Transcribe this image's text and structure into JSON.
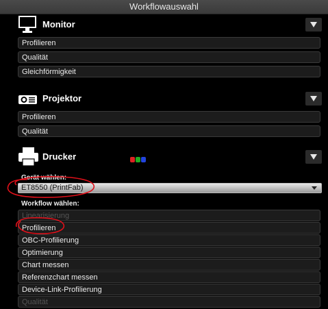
{
  "window": {
    "title": "Workflowauswahl"
  },
  "monitor": {
    "title": "Monitor",
    "items": [
      "Profilieren",
      "Qualität",
      "Gleichförmigkeit"
    ]
  },
  "projector": {
    "title": "Projektor",
    "items": [
      "Profilieren",
      "Qualität"
    ]
  },
  "printer": {
    "title": "Drucker",
    "device_label": "Gerät wählen:",
    "device_value": "ET8550  (PrintFab)",
    "workflow_label": "Workflow wählen:",
    "items": [
      {
        "label": "Linearisierung",
        "enabled": false
      },
      {
        "label": "Profilieren",
        "enabled": true
      },
      {
        "label": "OBC-Profilierung",
        "enabled": true
      },
      {
        "label": "Optimierung",
        "enabled": true
      },
      {
        "label": "Chart messen",
        "enabled": true
      },
      {
        "label": "Referenzchart messen",
        "enabled": true
      },
      {
        "label": "Device-Link-Profilierung",
        "enabled": true
      },
      {
        "label": "Qualität",
        "enabled": false
      }
    ]
  },
  "colors": {
    "annotation": "#e0101a",
    "badge_red": "#d22",
    "badge_green": "#2a2",
    "badge_blue": "#24d"
  }
}
